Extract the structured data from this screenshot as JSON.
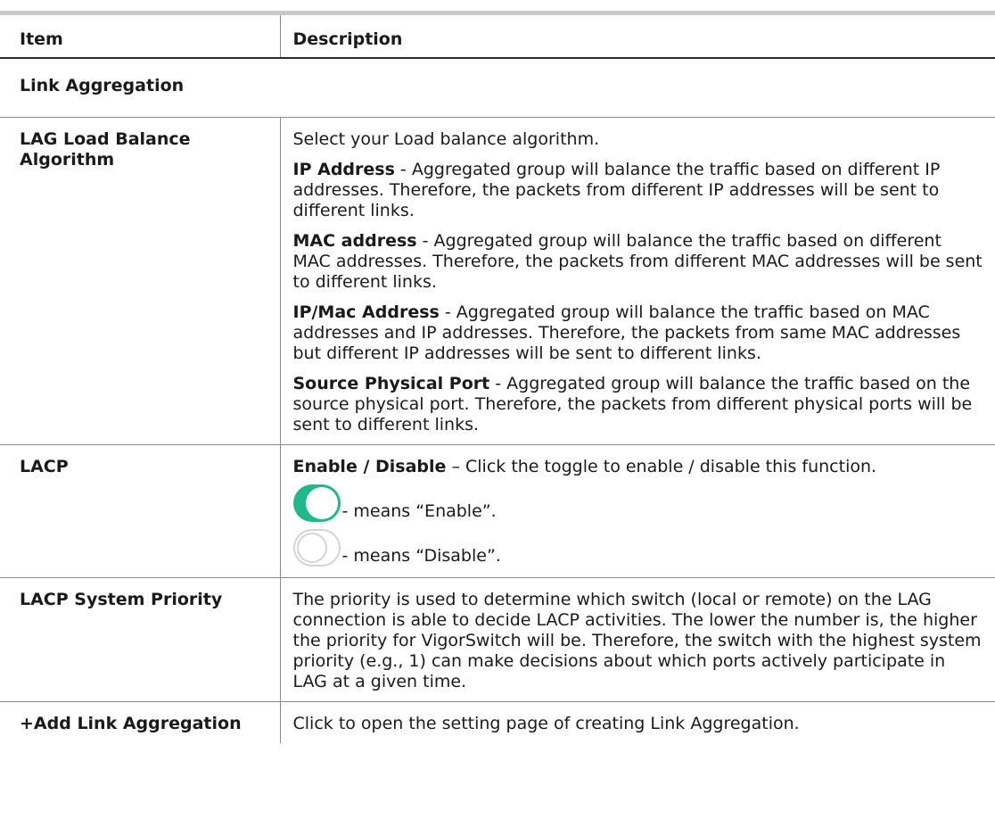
{
  "header": {
    "item": "Item",
    "description": "Description"
  },
  "section_title": "Link Aggregation",
  "rows": {
    "lag_algorithm": {
      "item": "LAG Load Balance Algorithm",
      "intro": "Select your Load balance algorithm.",
      "options": [
        {
          "term": "IP Address",
          "text": " - Aggregated group will balance the traffic based on different IP addresses. Therefore, the packets from different IP addresses will be sent to different links."
        },
        {
          "term": "MAC address",
          "text": " - Aggregated group will balance the traffic based on different MAC addresses. Therefore, the packets from different MAC addresses will be sent to different links."
        },
        {
          "term": "IP/Mac Address",
          "text": " - Aggregated group will balance the traffic based on MAC addresses and IP addresses. Therefore, the packets from same MAC addresses but different IP addresses will be sent to different links."
        },
        {
          "term": "Source Physical Port",
          "text": " - Aggregated group will balance the traffic based on the source physical port. Therefore, the packets from different physical ports will be sent to different links."
        }
      ]
    },
    "lacp": {
      "item": "LACP",
      "term": "Enable / Disable",
      "text": " – Click the toggle to enable / disable this function.",
      "enable_text": " - means “Enable”.",
      "disable_text": " - means “Disable”.",
      "toggle_on_color": "#21b98c",
      "toggle_off_color": "#d4d4d4"
    },
    "lacp_priority": {
      "item": "LACP System Priority",
      "text": "The priority is used to determine which switch (local or remote) on the LAG connection is able to decide LACP activities. The lower the number is, the higher the priority for VigorSwitch will be. Therefore, the switch with the highest system priority (e.g., 1) can make decisions about which ports actively participate in LAG at a given time."
    },
    "add_lag": {
      "item": "+Add Link Aggregation",
      "text": "Click to open the setting page of creating Link Aggregation."
    }
  }
}
